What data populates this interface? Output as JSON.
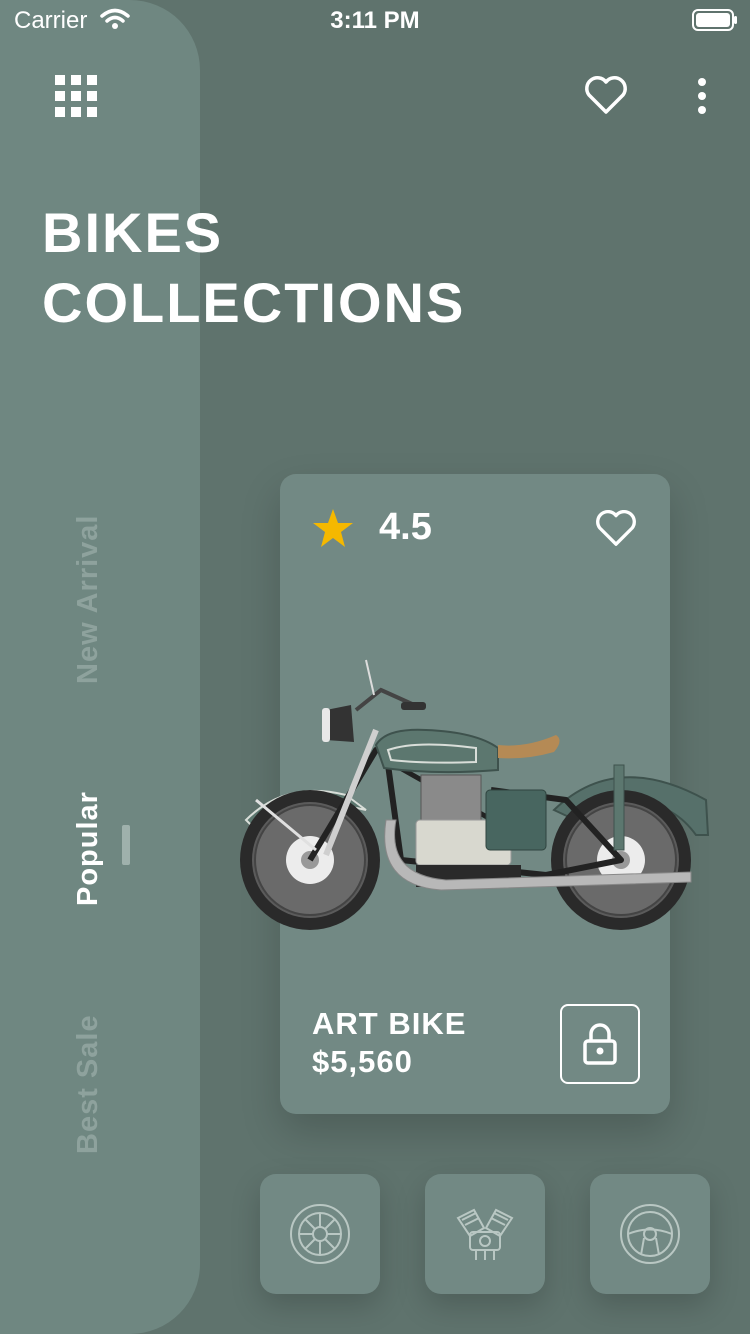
{
  "status_bar": {
    "carrier": "Carrier",
    "time": "3:11 PM"
  },
  "header": {
    "title_line1": "BIKES",
    "title_line2": "COLLECTIONS"
  },
  "tabs": [
    {
      "label": "New Arrival",
      "active": false
    },
    {
      "label": "Popular",
      "active": true
    },
    {
      "label": "Best Sale",
      "active": false
    }
  ],
  "product": {
    "rating": "4.5",
    "name": "ART BIKE",
    "price": "$5,560",
    "icons": [
      "star-icon",
      "heart-icon",
      "lock-icon"
    ]
  },
  "categories": [
    {
      "icon": "wheel-icon"
    },
    {
      "icon": "engine-icon"
    },
    {
      "icon": "steering-wheel-icon"
    }
  ],
  "colors": {
    "background": "#5f736d",
    "side_panel": "#6f8781",
    "card": "#728984",
    "star": "#f5b800",
    "inactive_tab": "#8ea29d"
  }
}
